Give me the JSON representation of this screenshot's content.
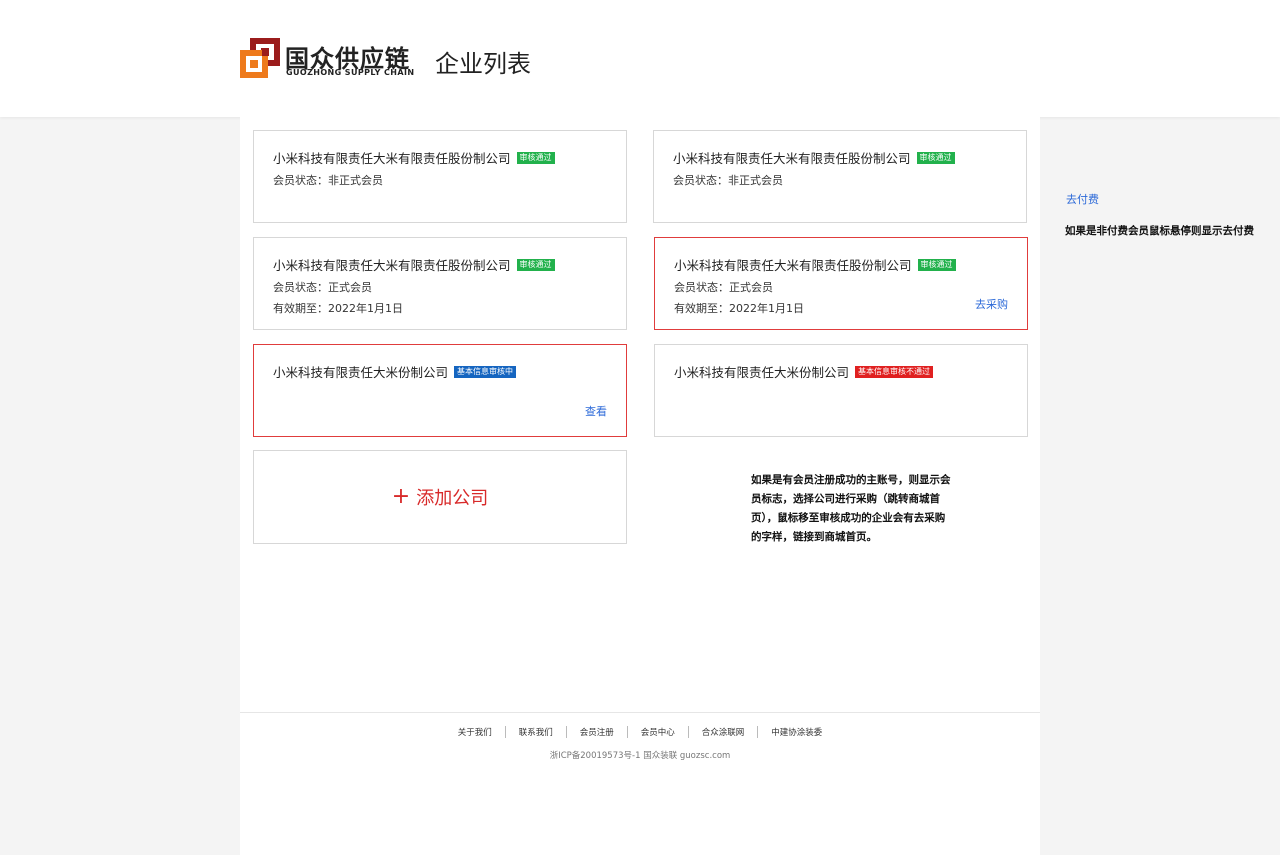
{
  "header": {
    "logo_cn": "国众供应链",
    "logo_en": "GUOZHONG SUPPLY CHAIN",
    "page_title": "企业列表"
  },
  "colors": {
    "accent_red": "#d82a2a",
    "link_blue": "#2d6ad8",
    "badge_green": "#22b14c",
    "badge_blue": "#1565c0",
    "badge_red": "#e02020",
    "logo_red": "#9b1c1c",
    "logo_orange": "#ee7a1c"
  },
  "cards": [
    {
      "name": "小米科技有限责任大米有限责任股份制公司",
      "badge": "审核通过",
      "line1": "会员状态：非正式会员",
      "line2": "",
      "action": ""
    },
    {
      "name": "小米科技有限责任大米有限责任股份制公司",
      "badge": "审核通过",
      "line1": "会员状态：非正式会员",
      "line2": "",
      "action": ""
    },
    {
      "name": "小米科技有限责任大米有限责任股份制公司",
      "badge": "审核通过",
      "line1": "会员状态：正式会员",
      "line2": "有效期至：2022年1月1日",
      "action": ""
    },
    {
      "name": "小米科技有限责任大米有限责任股份制公司",
      "badge": "审核通过",
      "line1": "会员状态：正式会员",
      "line2": "有效期至：2022年1月1日",
      "action": "去采购"
    },
    {
      "name": "小米科技有限责任大米份制公司",
      "badge": "基本信息审核中",
      "line1": "",
      "line2": "",
      "action": "查看"
    },
    {
      "name": "小米科技有限责任大米份制公司",
      "badge": "基本信息审核不通过",
      "line1": "",
      "line2": "",
      "action": ""
    }
  ],
  "add_company": {
    "plus": "+",
    "label": "添加公司"
  },
  "note": "如果是有会员注册成功的主账号，则显示会员标志，选择公司进行采购（跳转商城首页），鼠标移至审核成功的企业会有去采购的字样，链接到商城首页。",
  "side": {
    "pay_link": "去付费",
    "pay_note": "如果是非付费会员鼠标悬停则显示去付费"
  },
  "footer": {
    "links": [
      "关于我们",
      "联系我们",
      "会员注册",
      "会员中心",
      "合众涂联网",
      "中建协涂装委"
    ],
    "icp": "浙ICP备20019573号-1 国众装联 guozsc.com"
  }
}
